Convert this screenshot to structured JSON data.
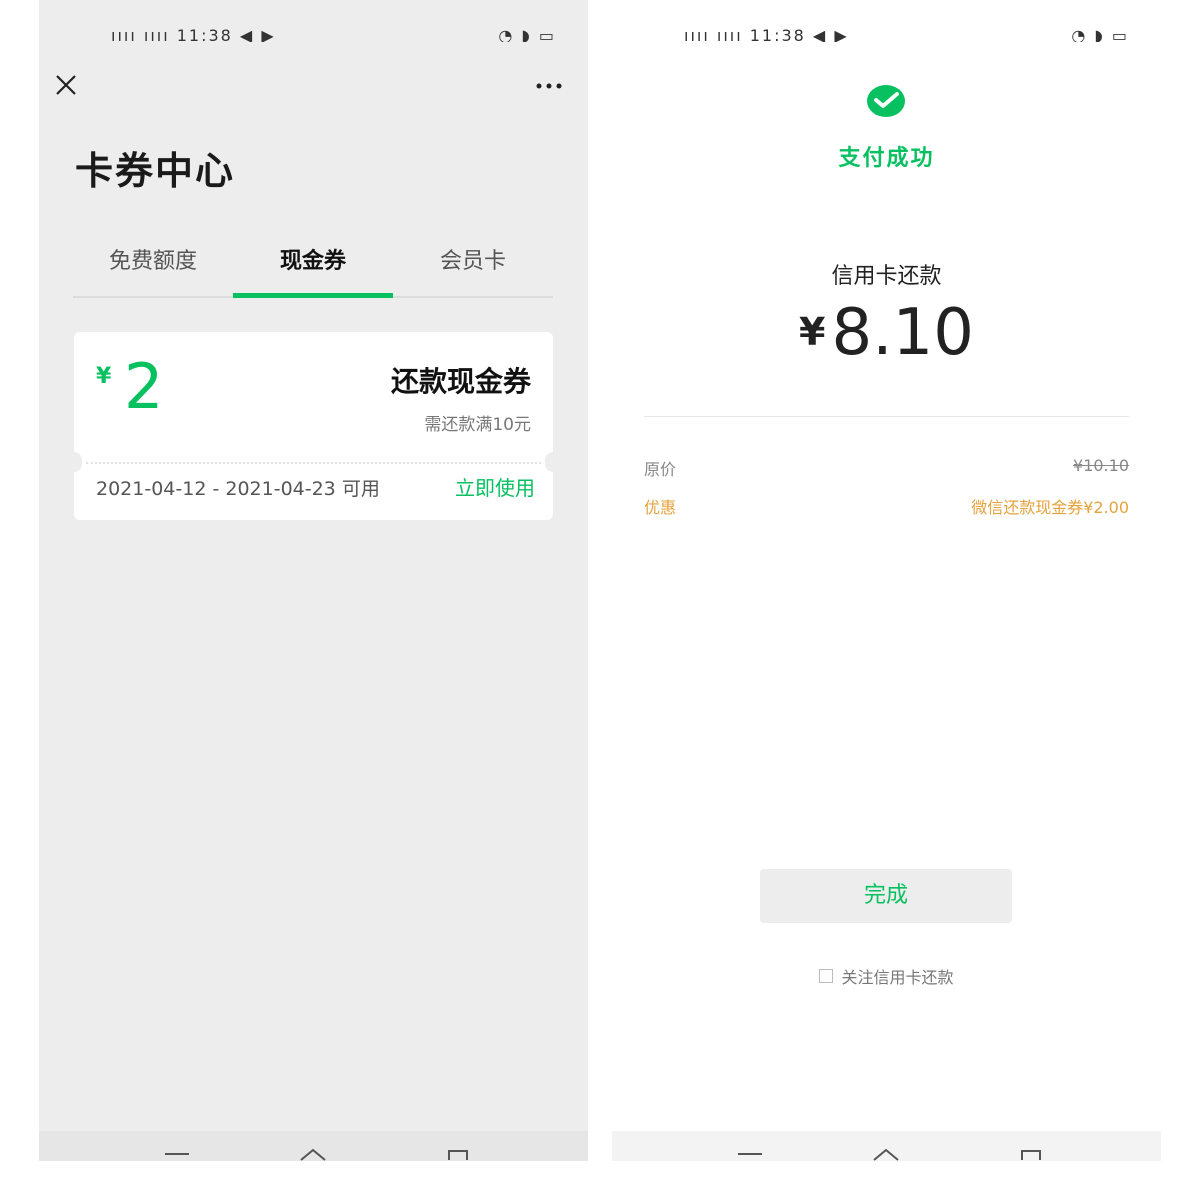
{
  "left_screen": {
    "statusbar": {
      "left_glyphs": "ıııı ıııı 11:38 ◀ ▶",
      "right_glyphs": "◔ ◗ ▭"
    },
    "page_title": "卡券中心",
    "tabs": [
      {
        "label": "免费额度",
        "active": false
      },
      {
        "label": "现金券",
        "active": true
      },
      {
        "label": "会员卡",
        "active": false
      }
    ],
    "coupon": {
      "currency": "¥",
      "amount": "2",
      "name": "还款现金券",
      "condition": "需还款满10元",
      "valid_period": "2021-04-12 - 2021-04-23 可用",
      "use_label": "立即使用"
    }
  },
  "right_screen": {
    "statusbar": {
      "left_glyphs": "ıııı ıııı 11:38 ◀ ▶",
      "right_glyphs": "◔ ◗ ▭"
    },
    "status": "支付成功",
    "item": "信用卡还款",
    "currency": "¥",
    "amount": "8.10",
    "details": [
      {
        "key": "原价",
        "value": "¥10.10"
      },
      {
        "key": "优惠",
        "value": "微信还款现金券¥2.00"
      }
    ],
    "done_label": "完成",
    "follow_label": "关注信用卡还款"
  },
  "colors": {
    "accent": "#07c160",
    "discount": "#e6a23c",
    "page_bg": "#ededed"
  }
}
